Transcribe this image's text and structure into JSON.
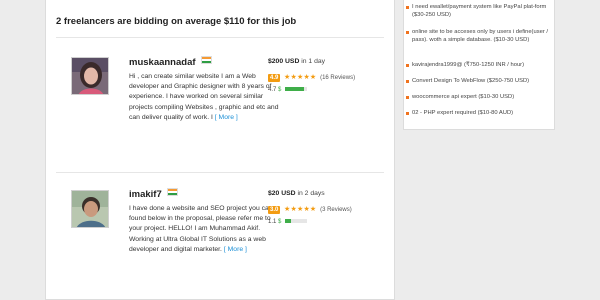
{
  "card": {
    "title": "2 freelancers are bidding on average $110 for this job"
  },
  "bids": [
    {
      "username": "muskaannadaf",
      "description": "Hi , can create similar website I am a Web developer and Graphic designer with 8 years of experience. I have worked on several similar projects compiling Websites , graphic and etc and can deliver quality of work. I",
      "more": "[ More ]",
      "price": "$200 USD",
      "duration": "in 1 day",
      "score": "4.9",
      "reviews": "(16 Reviews)",
      "earnings_score": "4.7",
      "earnings_level": 0.85
    },
    {
      "username": "imakif7",
      "description": "I have done a website and SEO project you can found below in the proposal, please refer me to your project. HELLO! I am Muhammad Akif. Working at Ultra Global IT Solutions as a web developer and digital marketer.",
      "more": "[ More ]",
      "price": "$20 USD",
      "duration": "in 2 days",
      "score": "3.0",
      "reviews": "(3 Reviews)",
      "earnings_score": "1.1",
      "earnings_level": 0.25
    }
  ],
  "side_jobs": [
    "I need ewallet/payment system like PayPal plat-form ($30-250 USD)",
    "online site to be acceses only by users i define(user / pass). woth a simple database. ($10-30 USD)",
    "kavirajendra1999@ (₹750-1250 INR / hour)",
    "Convert Design To WebFlow ($250-750 USD)",
    "woocommerce api expert ($10-30 USD)",
    "02 - PHP expert required ($10-80 AUD)"
  ],
  "colors": {
    "accent": "#f39c12",
    "link": "#1a8fd6",
    "earn": "#3fae49",
    "bullet": "#f0731e"
  },
  "icons": {
    "flag": "india-flag-icon",
    "star": "star-icon",
    "earnings": "earnings-icon"
  }
}
